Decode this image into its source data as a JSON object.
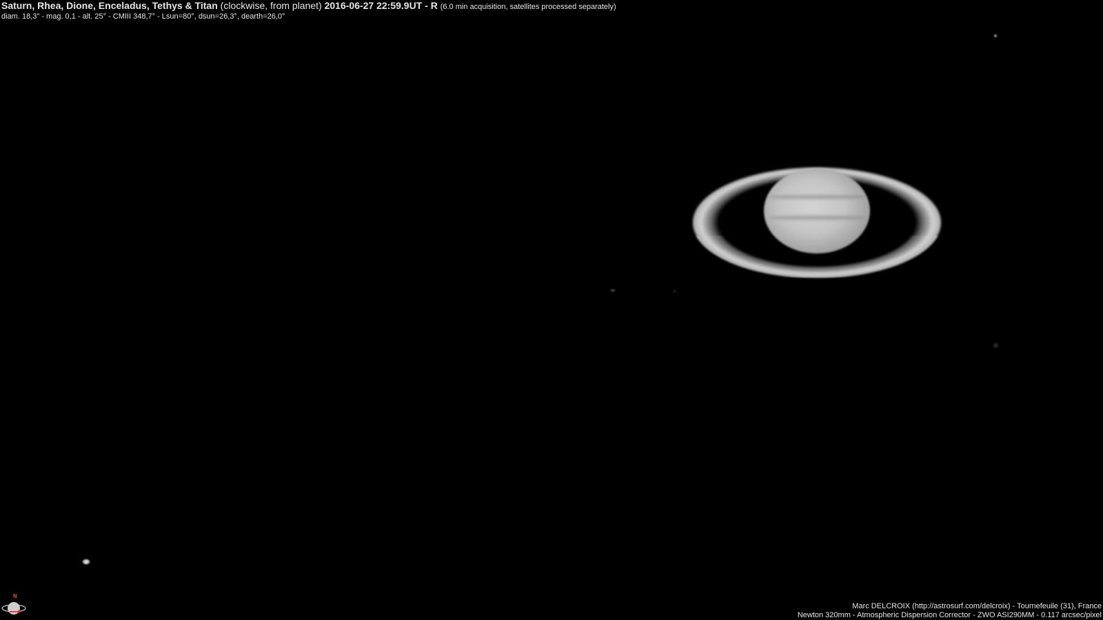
{
  "header": {
    "title_bold": "Saturn, Rhea, Dione, Enceladus, Tethys & Titan",
    "title_paren": "(clockwise, from planet)",
    "title_date": "2016-06-27 22:59.9UT - R",
    "title_note": "(6.0 min acquisition, satellites processed separately)",
    "info_line": "diam. 18,3\" - mag. 0,1 - alt. 25° - CMIII 348,7° - Lsun=80°, dsun=26,3°, dearth=26,0°"
  },
  "footer": {
    "author_line": "Marc DELCROIX (http://astrosurf.com/delcroix) - Tournefeuile (31), France",
    "equipment_line": "Newton 320mm -  Atmospheric Dispersion Corrector - ZWO ASI290MM - 0.117 arcsec/pixel"
  },
  "compass": {
    "north_label": "N",
    "icon": "compass-icon",
    "north_color": "#e05a1a",
    "arrow_color": "#e02020"
  },
  "colors": {
    "background": "#000000",
    "text": "#e6e6e6"
  }
}
